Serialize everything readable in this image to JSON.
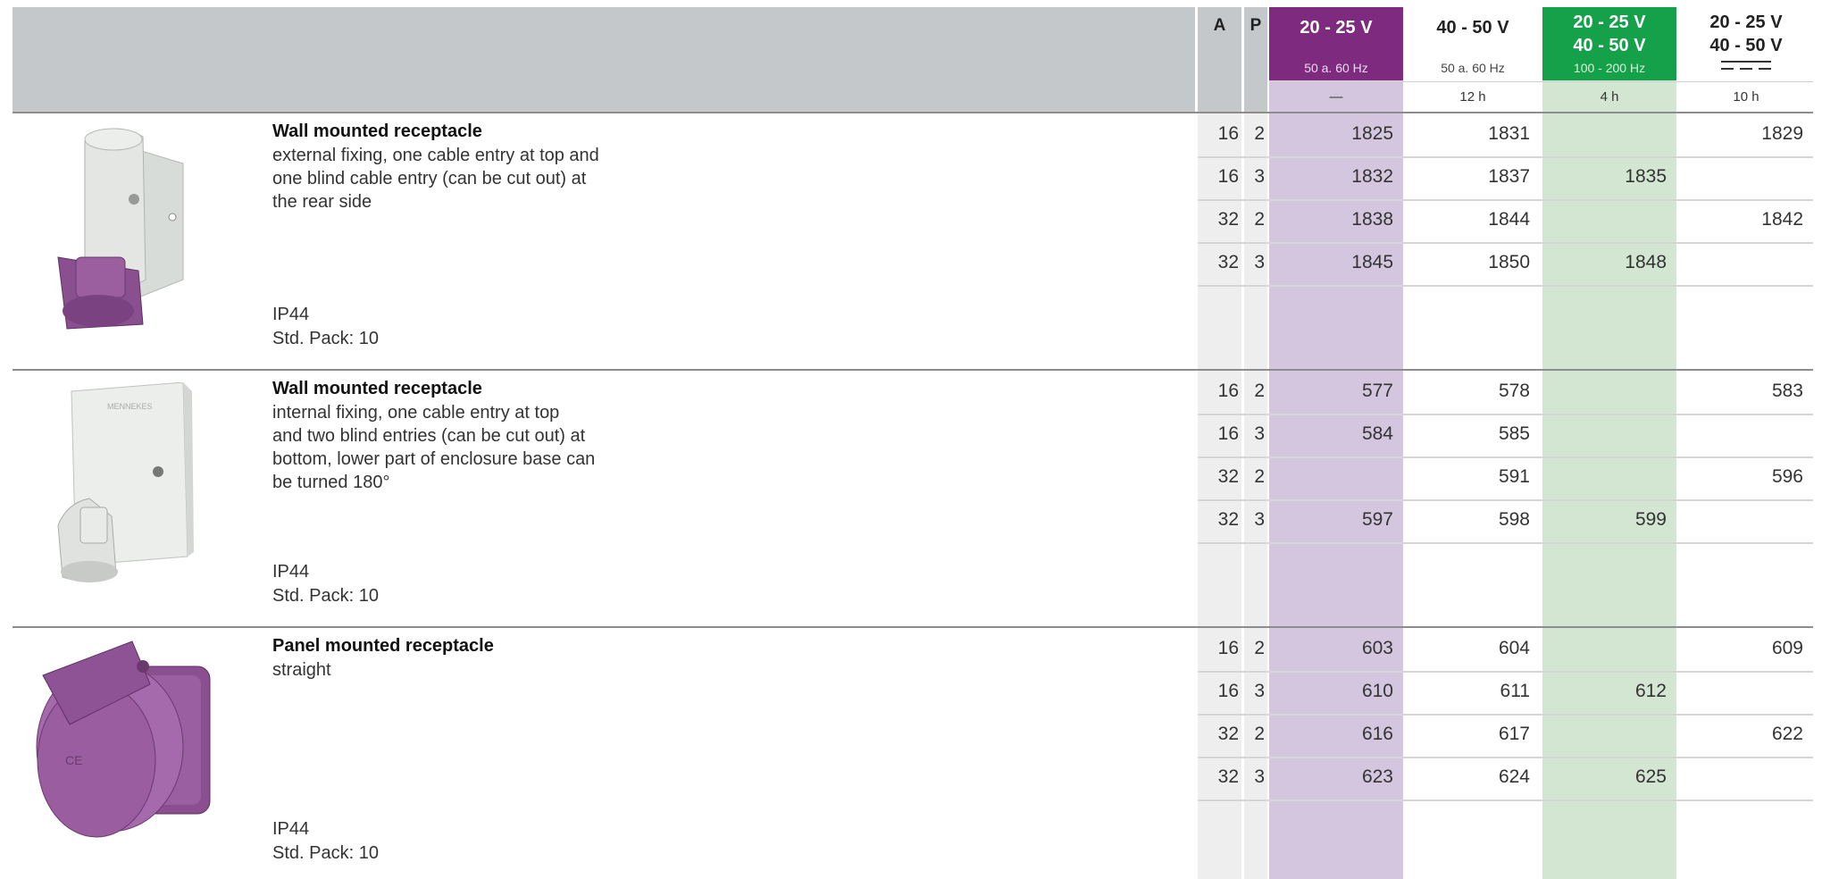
{
  "header": {
    "col_a": "A",
    "col_p": "P",
    "columns": [
      {
        "voltage_line1": "20 - 25 V",
        "voltage_line2": "",
        "frequency": "50 a. 60 Hz",
        "duration": "—",
        "color": "#7e2a7e"
      },
      {
        "voltage_line1": "40 - 50 V",
        "voltage_line2": "",
        "frequency": "50 a. 60 Hz",
        "duration": "12 h",
        "color": "#ffffff"
      },
      {
        "voltage_line1": "20 - 25 V",
        "voltage_line2": "40 - 50 V",
        "frequency": "100 - 200 Hz",
        "duration": "4 h",
        "color": "#14a14a"
      },
      {
        "voltage_line1": "20 - 25 V",
        "voltage_line2": "40 - 50 V",
        "frequency_icon": "dc-symbol-icon",
        "duration": "10 h",
        "color": "#ffffff"
      }
    ]
  },
  "products": [
    {
      "title": "Wall mounted receptacle",
      "description": [
        "external fixing, one cable entry at top and",
        "one blind cable entry (can be cut out) at",
        "the rear side"
      ],
      "ip": "IP44",
      "pack": "Std. Pack: 10",
      "image_icon": "wall-receptacle-external-icon",
      "rows": [
        {
          "a": "16",
          "p": "2",
          "c1": "1825",
          "c2": "1831",
          "c3": "",
          "c4": "1829"
        },
        {
          "a": "16",
          "p": "3",
          "c1": "1832",
          "c2": "1837",
          "c3": "1835",
          "c4": ""
        },
        {
          "a": "32",
          "p": "2",
          "c1": "1838",
          "c2": "1844",
          "c3": "",
          "c4": "1842"
        },
        {
          "a": "32",
          "p": "3",
          "c1": "1845",
          "c2": "1850",
          "c3": "1848",
          "c4": ""
        }
      ]
    },
    {
      "title": "Wall mounted receptacle",
      "description": [
        "internal fixing, one cable entry at top",
        "and two blind entries (can be cut out) at",
        "bottom, lower part of enclosure base can",
        "be turned 180°"
      ],
      "ip": "IP44",
      "pack": "Std. Pack: 10",
      "image_icon": "wall-receptacle-internal-icon",
      "rows": [
        {
          "a": "16",
          "p": "2",
          "c1": "577",
          "c2": "578",
          "c3": "",
          "c4": "583"
        },
        {
          "a": "16",
          "p": "3",
          "c1": "584",
          "c2": "585",
          "c3": "",
          "c4": ""
        },
        {
          "a": "32",
          "p": "2",
          "c1": "",
          "c2": "591",
          "c3": "",
          "c4": "596"
        },
        {
          "a": "32",
          "p": "3",
          "c1": "597",
          "c2": "598",
          "c3": "599",
          "c4": ""
        }
      ]
    },
    {
      "title": "Panel mounted receptacle",
      "description": [
        "straight"
      ],
      "ip": "IP44",
      "pack": "Std. Pack: 10",
      "image_icon": "panel-receptacle-icon",
      "rows": [
        {
          "a": "16",
          "p": "2",
          "c1": "603",
          "c2": "604",
          "c3": "",
          "c4": "609"
        },
        {
          "a": "16",
          "p": "3",
          "c1": "610",
          "c2": "611",
          "c3": "612",
          "c4": ""
        },
        {
          "a": "32",
          "p": "2",
          "c1": "616",
          "c2": "617",
          "c3": "",
          "c4": "622"
        },
        {
          "a": "32",
          "p": "3",
          "c1": "623",
          "c2": "624",
          "c3": "625",
          "c4": ""
        }
      ]
    }
  ]
}
